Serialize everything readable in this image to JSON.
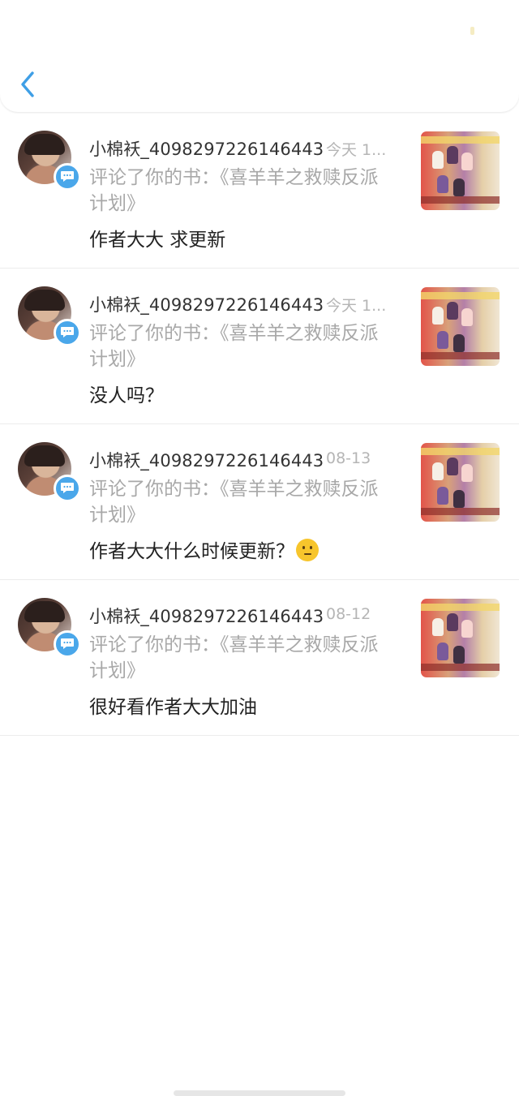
{
  "header": {
    "back_icon": "chevron-left-icon",
    "accent": "#3f9fe6"
  },
  "comments": [
    {
      "user": "小棉袄_4098297226146443",
      "time": "今天 1...",
      "action": "评论了你的书：《喜羊羊之救赎反派计划》",
      "content": "作者大大 求更新",
      "emoji": null
    },
    {
      "user": "小棉袄_4098297226146443",
      "time": "今天 1...",
      "action": "评论了你的书：《喜羊羊之救赎反派计划》",
      "content": "没人吗？",
      "emoji": null
    },
    {
      "user": "小棉袄_4098297226146443",
      "time": "08-13",
      "action": "评论了你的书：《喜羊羊之救赎反派计划》",
      "content": "作者大大什么时候更新？",
      "emoji": "thinking-face-icon"
    },
    {
      "user": "小棉袄_4098297226146443",
      "time": "08-12",
      "action": "评论了你的书：《喜羊羊之救赎反派计划》",
      "content": "很好看作者大大加油",
      "emoji": null
    }
  ],
  "colors": {
    "badge": "#4aa7ea",
    "name": "#333333",
    "secondary": "#a8a8a8",
    "content": "#222222"
  }
}
